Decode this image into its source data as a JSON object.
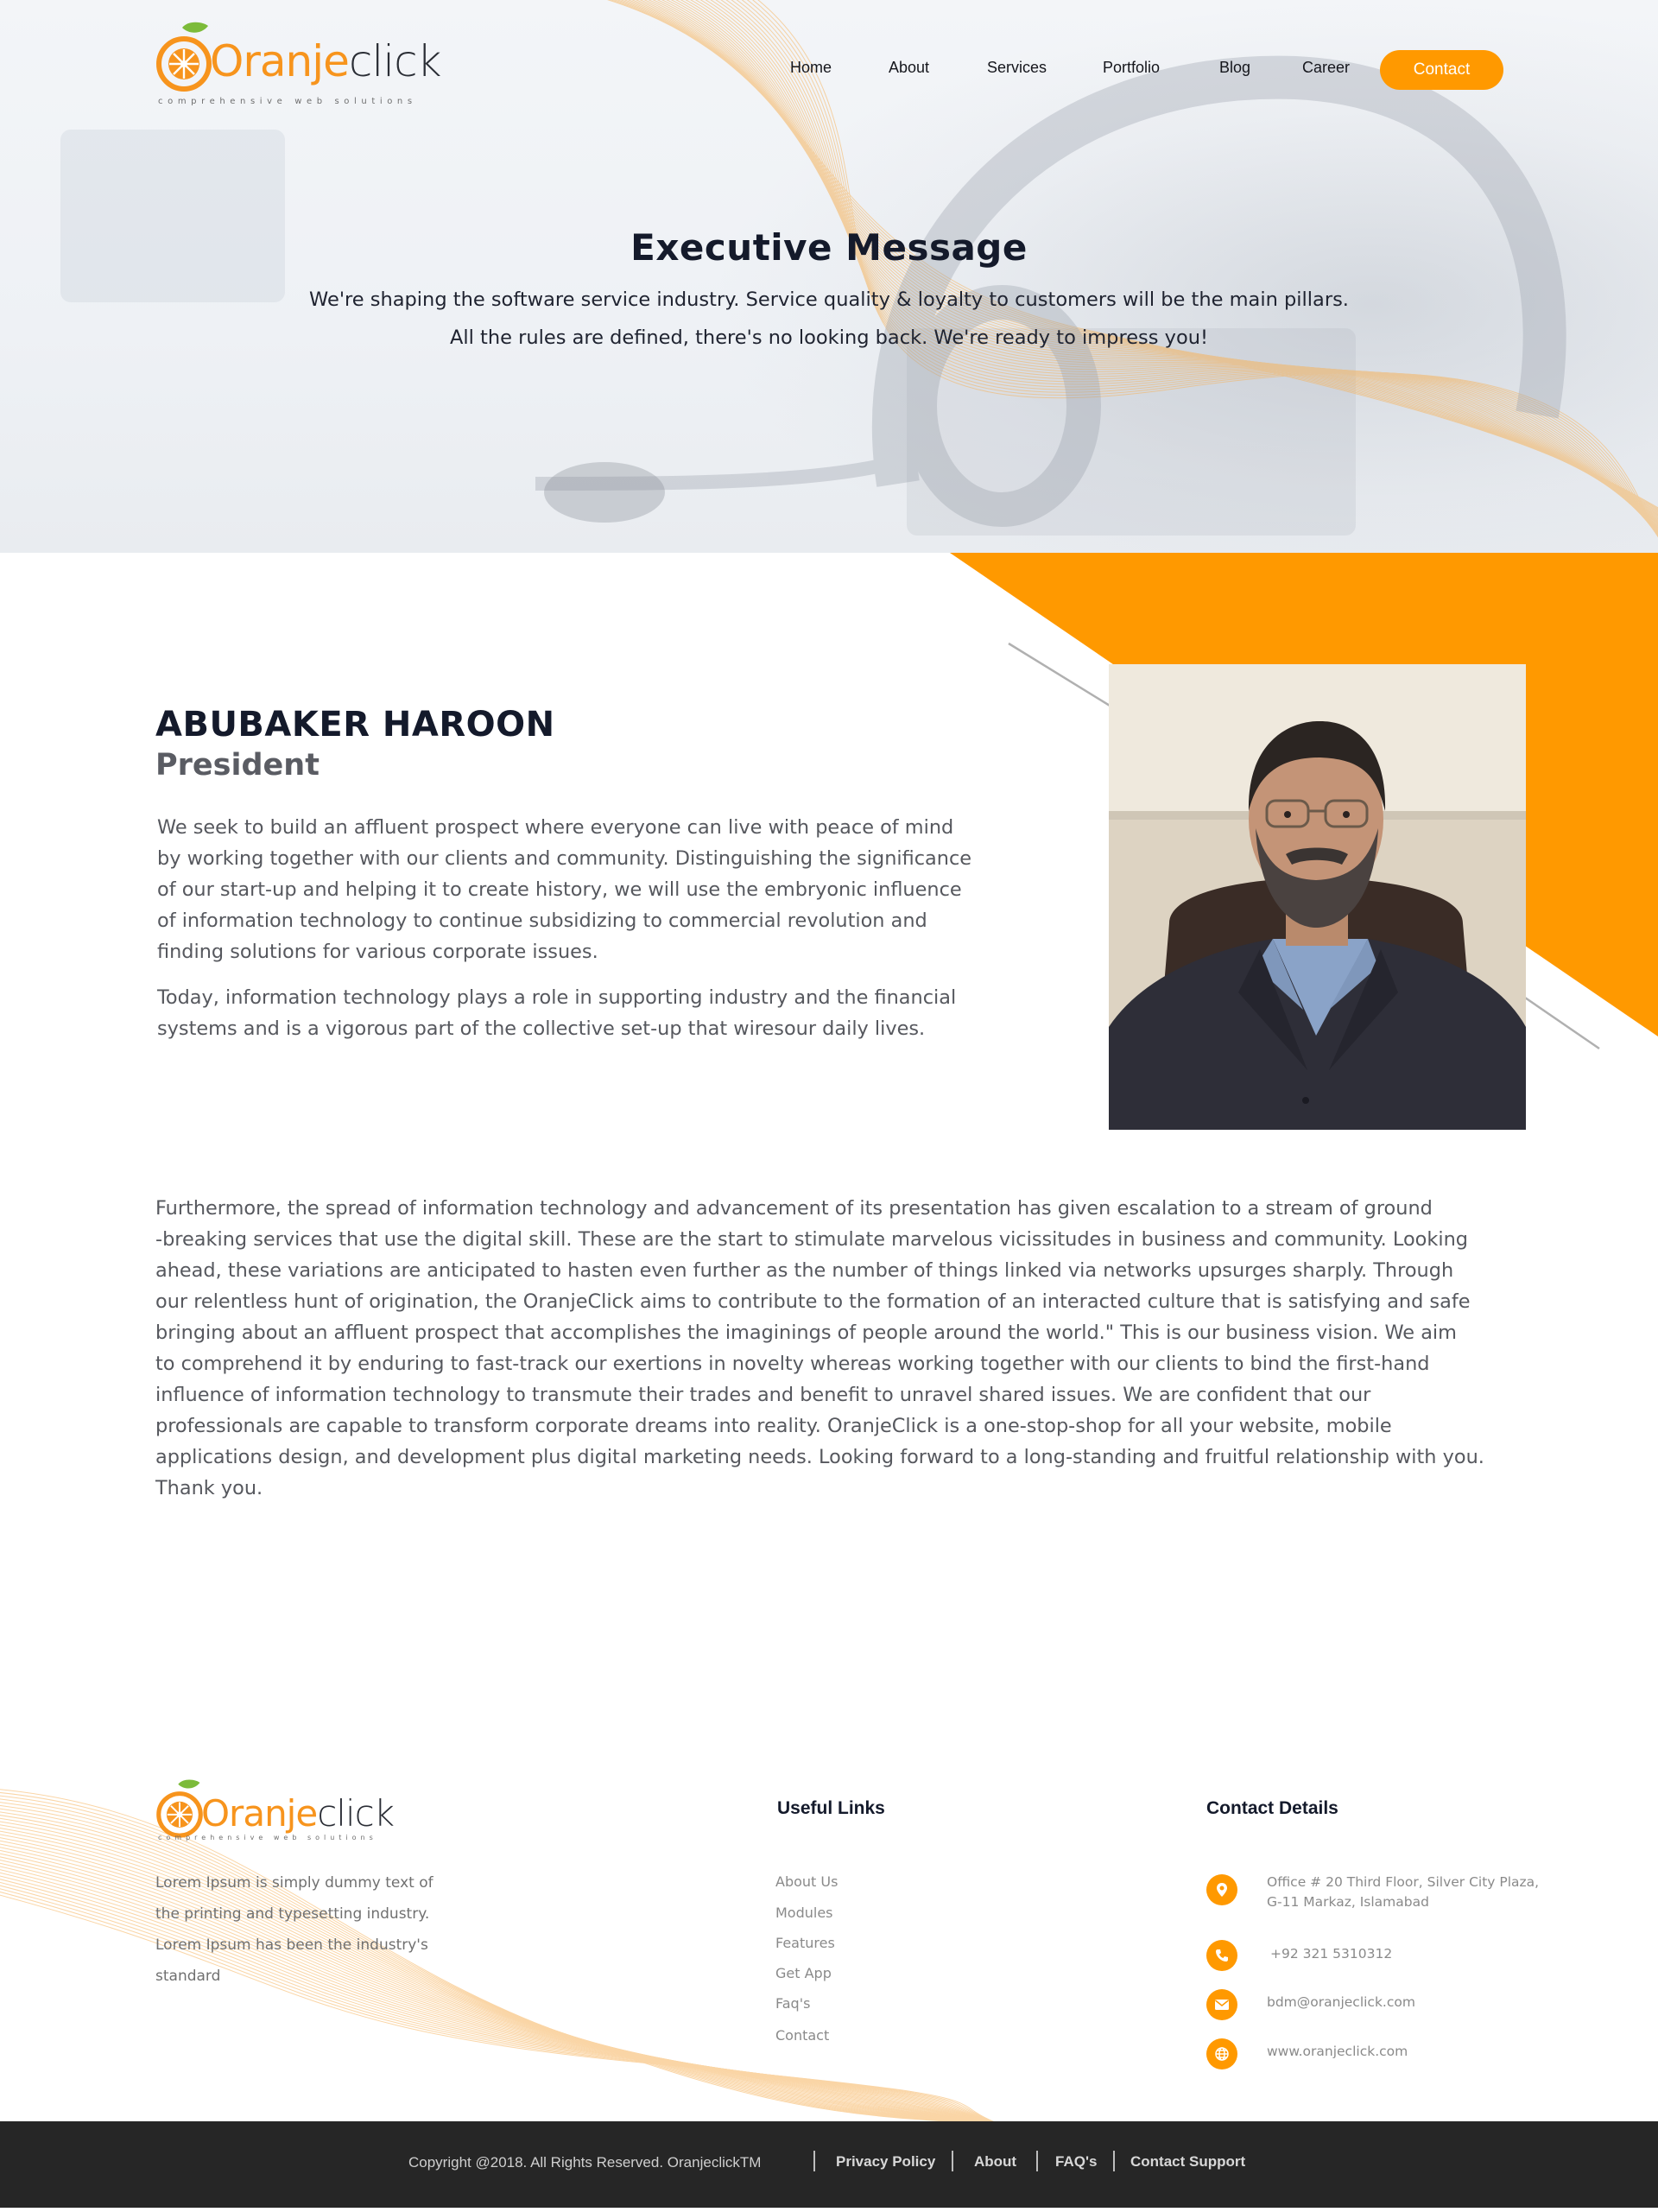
{
  "brand": {
    "name_part1": "Oranje",
    "name_part2": "click",
    "tagline": "comprehensive web solutions"
  },
  "nav": {
    "items": [
      "Home",
      "About",
      "Services",
      "Portfolio",
      "Blog",
      "Career"
    ],
    "contact_button": "Contact"
  },
  "hero": {
    "title": "Executive Message",
    "line1": "We're shaping the software service industry. Service quality & loyalty to customers will be the main pillars.",
    "line2": "All the rules are defined, there's no looking back. We're ready to impress you!"
  },
  "profile": {
    "name": "ABUBAKER HAROON",
    "role": "President",
    "para1_lines": [
      "We seek to build an affluent prospect where everyone can live with peace of mind",
      "by working together with our clients and community. Distinguishing the significance",
      "of our start-up and helping it to create history, we will use the embryonic influence",
      "of information technology to continue subsidizing to commercial revolution and",
      "finding solutions for various corporate issues."
    ],
    "para2_lines": [
      "Today, information technology plays a role in supporting industry and the financial",
      "systems and is a vigorous part of the collective set-up that wiresour daily lives."
    ]
  },
  "body": {
    "lines": [
      "Furthermore, the spread of information technology and advancement of its presentation has given escalation to a stream of ground",
      "-breaking services that use the digital skill. These are the start to stimulate marvelous vicissitudes in business and community. Looking",
      "ahead, these variations are anticipated to hasten even further as the number of things linked via networks upsurges sharply. Through",
      "our relentless hunt of origination, the OranjeClick aims to contribute to the formation of an interacted culture that is satisfying and safe",
      "bringing about an affluent prospect that accomplishes the imaginings of people around the world.\" This is our business vision. We aim",
      "to comprehend it by enduring to fast-track our exertions in novelty whereas working together with our clients to bind the first-hand",
      "influence of information technology to transmute their trades and benefit to unravel shared issues. We are confident that our",
      "professionals are capable to transform corporate dreams into reality. OranjeClick is a one-stop-shop for all your website, mobile",
      "applications design, and development plus digital marketing needs. Looking forward to a long-standing and fruitful relationship with you.",
      "Thank you."
    ]
  },
  "footer": {
    "blurb_lines": [
      "Lorem Ipsum is simply dummy text of",
      "the printing and typesetting industry.",
      "Lorem Ipsum has been the industry's",
      "standard"
    ],
    "useful_links_heading": "Useful Links",
    "useful_links": [
      "About Us",
      "Modules",
      "Features",
      "Get App",
      "Faq's",
      "Contact"
    ],
    "contact_heading": "Contact Details",
    "address_line1": "Office # 20 Third Floor, Silver City Plaza,",
    "address_line2": "G-11 Markaz, Islamabad",
    "phone": "+92 321 5310312",
    "email": "bdm@oranjeclick.com",
    "website": "www.oranjeclick.com"
  },
  "bottom_bar": {
    "copyright": "Copyright @2018. All Rights Reserved. OranjeclickTM",
    "links": [
      "Privacy Policy",
      "About",
      "FAQ's",
      "Contact Support"
    ]
  },
  "colors": {
    "accent": "#ff9900",
    "dark_text": "#141a2b",
    "bottom_bar": "#262626"
  }
}
